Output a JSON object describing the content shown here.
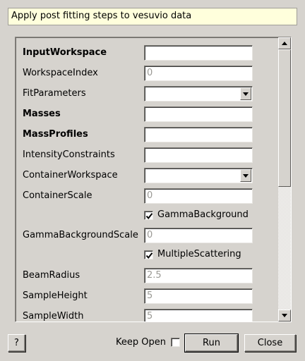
{
  "description": "Apply post fitting steps to vesuvio data",
  "properties": [
    {
      "label": "InputWorkspace",
      "bold": true,
      "kind": "text",
      "value": ""
    },
    {
      "label": "WorkspaceIndex",
      "bold": false,
      "kind": "text",
      "value": "0"
    },
    {
      "label": "FitParameters",
      "bold": false,
      "kind": "combo",
      "value": ""
    },
    {
      "label": "Masses",
      "bold": true,
      "kind": "text",
      "value": ""
    },
    {
      "label": "MassProfiles",
      "bold": true,
      "kind": "text",
      "value": ""
    },
    {
      "label": "IntensityConstraints",
      "bold": false,
      "kind": "text",
      "value": ""
    },
    {
      "label": "ContainerWorkspace",
      "bold": false,
      "kind": "combo",
      "value": ""
    },
    {
      "label": "ContainerScale",
      "bold": false,
      "kind": "text",
      "value": "0"
    },
    {
      "label": "GammaBackground",
      "bold": false,
      "kind": "check",
      "checked": true
    },
    {
      "label": "GammaBackgroundScale",
      "bold": false,
      "kind": "text",
      "value": "0"
    },
    {
      "label": "MultipleScattering",
      "bold": false,
      "kind": "check",
      "checked": true
    },
    {
      "label": "BeamRadius",
      "bold": false,
      "kind": "text",
      "value": "2.5"
    },
    {
      "label": "SampleHeight",
      "bold": false,
      "kind": "text",
      "value": "5"
    },
    {
      "label": "SampleWidth",
      "bold": false,
      "kind": "text",
      "value": "5"
    }
  ],
  "buttons": {
    "help": "?",
    "keep_open": "Keep Open",
    "run": "Run",
    "close": "Close"
  },
  "icons": {
    "combo_arrow": "chevron-down-icon",
    "scroll_up": "arrow-up-icon",
    "scroll_down": "arrow-down-icon",
    "checkmark": "check-icon"
  },
  "colors": {
    "window_bg": "#d6d3ce",
    "description_bg": "#ffffdc",
    "disabled_text": "#9a9994"
  }
}
